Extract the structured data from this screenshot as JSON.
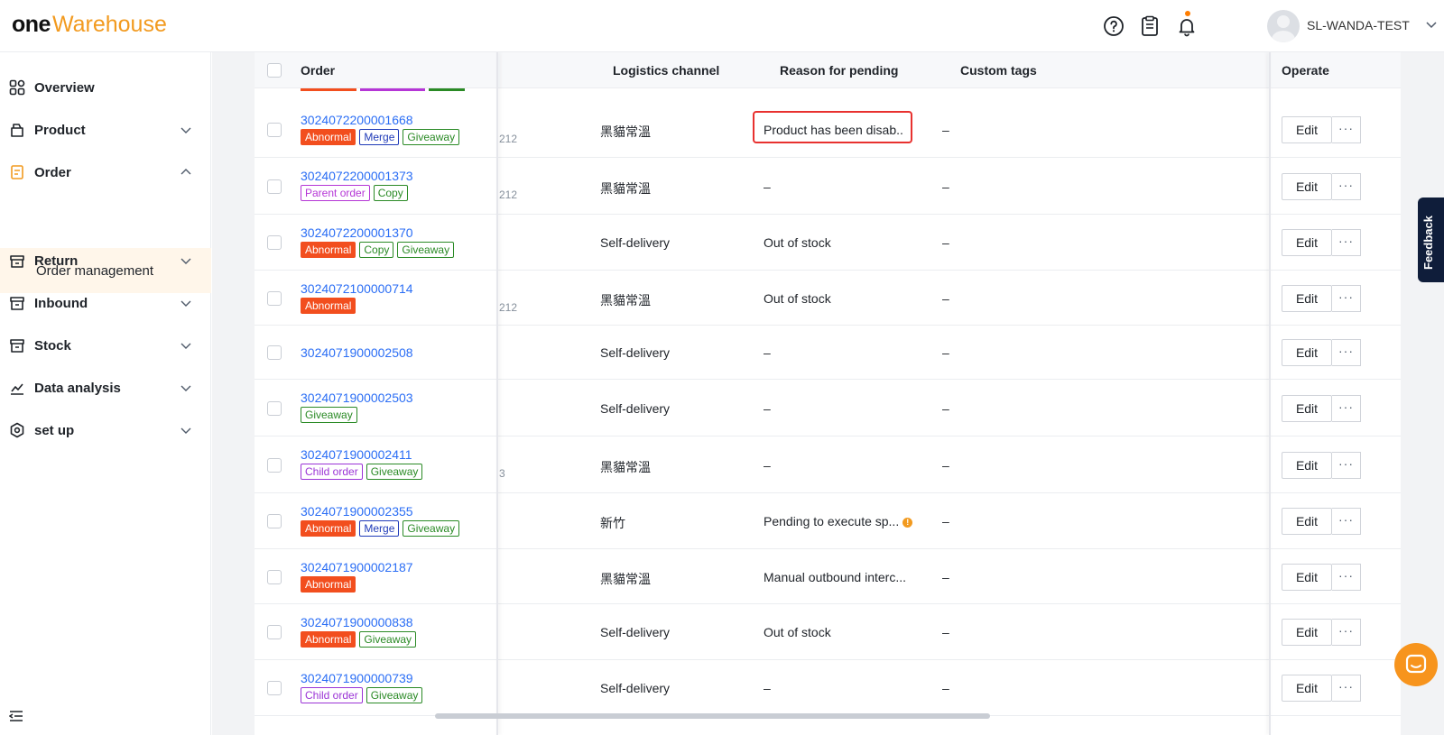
{
  "header": {
    "logo_one": "one",
    "logo_warehouse": "Warehouse",
    "help_icon": "help-circle-icon",
    "tasks_icon": "clipboard-icon",
    "notify_icon": "bell-icon",
    "username": "SL-WANDA-TEST"
  },
  "sidebar": {
    "items": [
      {
        "label": "Overview",
        "icon": "overview-icon"
      },
      {
        "label": "Product",
        "icon": "product-icon"
      },
      {
        "label": "Order",
        "icon": "order-icon"
      },
      {
        "label": "Return",
        "icon": "return-icon"
      },
      {
        "label": "Inbound",
        "icon": "inbound-icon"
      },
      {
        "label": "Stock",
        "icon": "stock-icon"
      },
      {
        "label": "Data analysis",
        "icon": "chart-icon"
      },
      {
        "label": "set up",
        "icon": "settings-icon"
      }
    ],
    "active_sub": "Order management"
  },
  "table": {
    "columns": {
      "order": "Order",
      "logistics": "Logistics channel",
      "reason": "Reason for pending",
      "tags": "Custom tags",
      "operate": "Operate"
    },
    "edit_label": "Edit",
    "more_label": "···",
    "rows": [
      {
        "id": "3024072200001668",
        "tags": [
          "Abnormal",
          "Merge",
          "Giveaway"
        ],
        "frag": "212",
        "logistics": "黑貓常溫",
        "reason": "Product has been disab..",
        "custom": "–"
      },
      {
        "id": "3024072200001373",
        "tags": [
          "Parent order",
          "Copy"
        ],
        "frag": "212",
        "logistics": "黑貓常溫",
        "reason": "–",
        "custom": "–"
      },
      {
        "id": "3024072200001370",
        "tags": [
          "Abnormal",
          "Copy",
          "Giveaway"
        ],
        "frag": "",
        "logistics": "Self-delivery",
        "reason": "Out of stock",
        "custom": "–"
      },
      {
        "id": "3024072100000714",
        "tags": [
          "Abnormal"
        ],
        "frag": "212",
        "logistics": "黑貓常溫",
        "reason": "Out of stock",
        "custom": "–"
      },
      {
        "id": "3024071900002508",
        "tags": [],
        "frag": "",
        "logistics": "Self-delivery",
        "reason": "–",
        "custom": "–"
      },
      {
        "id": "3024071900002503",
        "tags": [
          "Giveaway"
        ],
        "frag": "",
        "logistics": "Self-delivery",
        "reason": "–",
        "custom": "–"
      },
      {
        "id": "3024071900002411",
        "tags": [
          "Child order",
          "Giveaway"
        ],
        "frag": "3",
        "logistics": "黑貓常溫",
        "reason": "–",
        "custom": "–"
      },
      {
        "id": "3024071900002355",
        "tags": [
          "Abnormal",
          "Merge",
          "Giveaway"
        ],
        "frag": "",
        "logistics": "新竹",
        "reason": "Pending to execute sp...",
        "custom": "–"
      },
      {
        "id": "3024071900002187",
        "tags": [
          "Abnormal"
        ],
        "frag": "",
        "logistics": "黑貓常溫",
        "reason": "Manual outbound interc...",
        "custom": "–"
      },
      {
        "id": "3024071900000838",
        "tags": [
          "Abnormal",
          "Giveaway"
        ],
        "frag": "",
        "logistics": "Self-delivery",
        "reason": "Out of stock",
        "custom": "–"
      },
      {
        "id": "3024071900000739",
        "tags": [
          "Child order",
          "Giveaway"
        ],
        "frag": "",
        "logistics": "Self-delivery",
        "reason": "–",
        "custom": "–"
      }
    ]
  },
  "feedback_label": "Feedback",
  "chat_icon": "chat-icon",
  "colors": {
    "brand_orange": "#f29a1f",
    "link_blue": "#2b6ef5",
    "abnormal_red": "#f24e1e",
    "highlight_red": "#e8312f"
  }
}
